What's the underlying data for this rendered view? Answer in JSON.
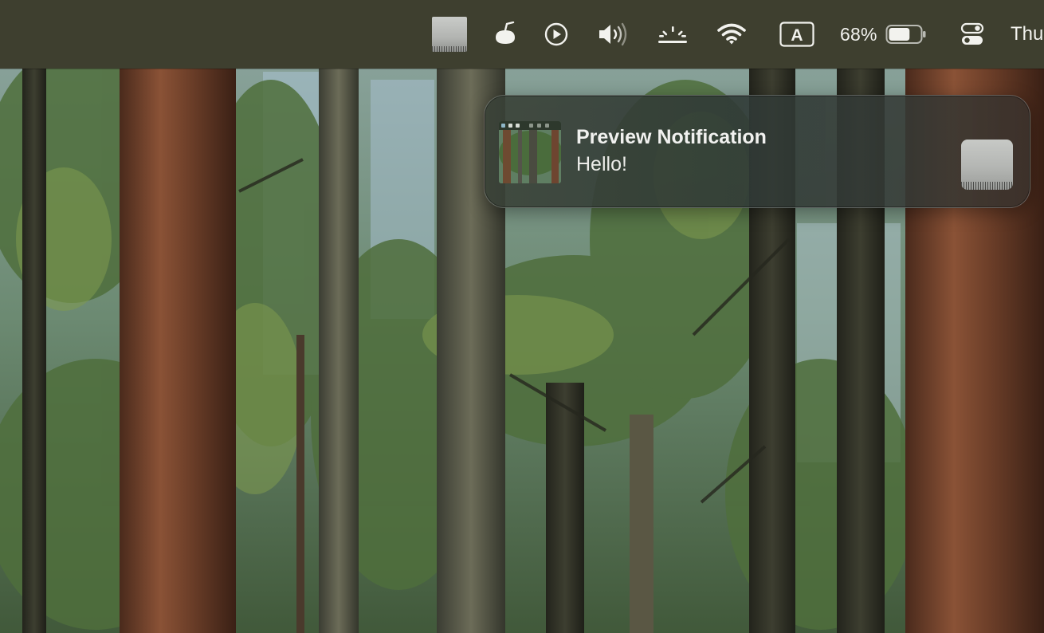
{
  "menubar": {
    "items": [
      {
        "icon": "image-thumbnail-icon"
      },
      {
        "icon": "lamp-icon"
      },
      {
        "icon": "play-circle-icon"
      },
      {
        "icon": "volume-icon"
      },
      {
        "icon": "brightness-icon"
      },
      {
        "icon": "wifi-icon"
      },
      {
        "icon": "input-source-icon",
        "label": "A"
      },
      {
        "icon": "battery-icon",
        "label": "68%",
        "level": 0.68
      },
      {
        "icon": "control-center-icon"
      }
    ],
    "clock": "Thu"
  },
  "notification": {
    "title": "Preview Notification",
    "body": "Hello!",
    "app_icon": "preview-app-icon",
    "attachment": "image-attachment-icon"
  },
  "colors": {
    "menubar_bg": "#3e3f2f",
    "menubar_text": "#f2f2ee"
  }
}
